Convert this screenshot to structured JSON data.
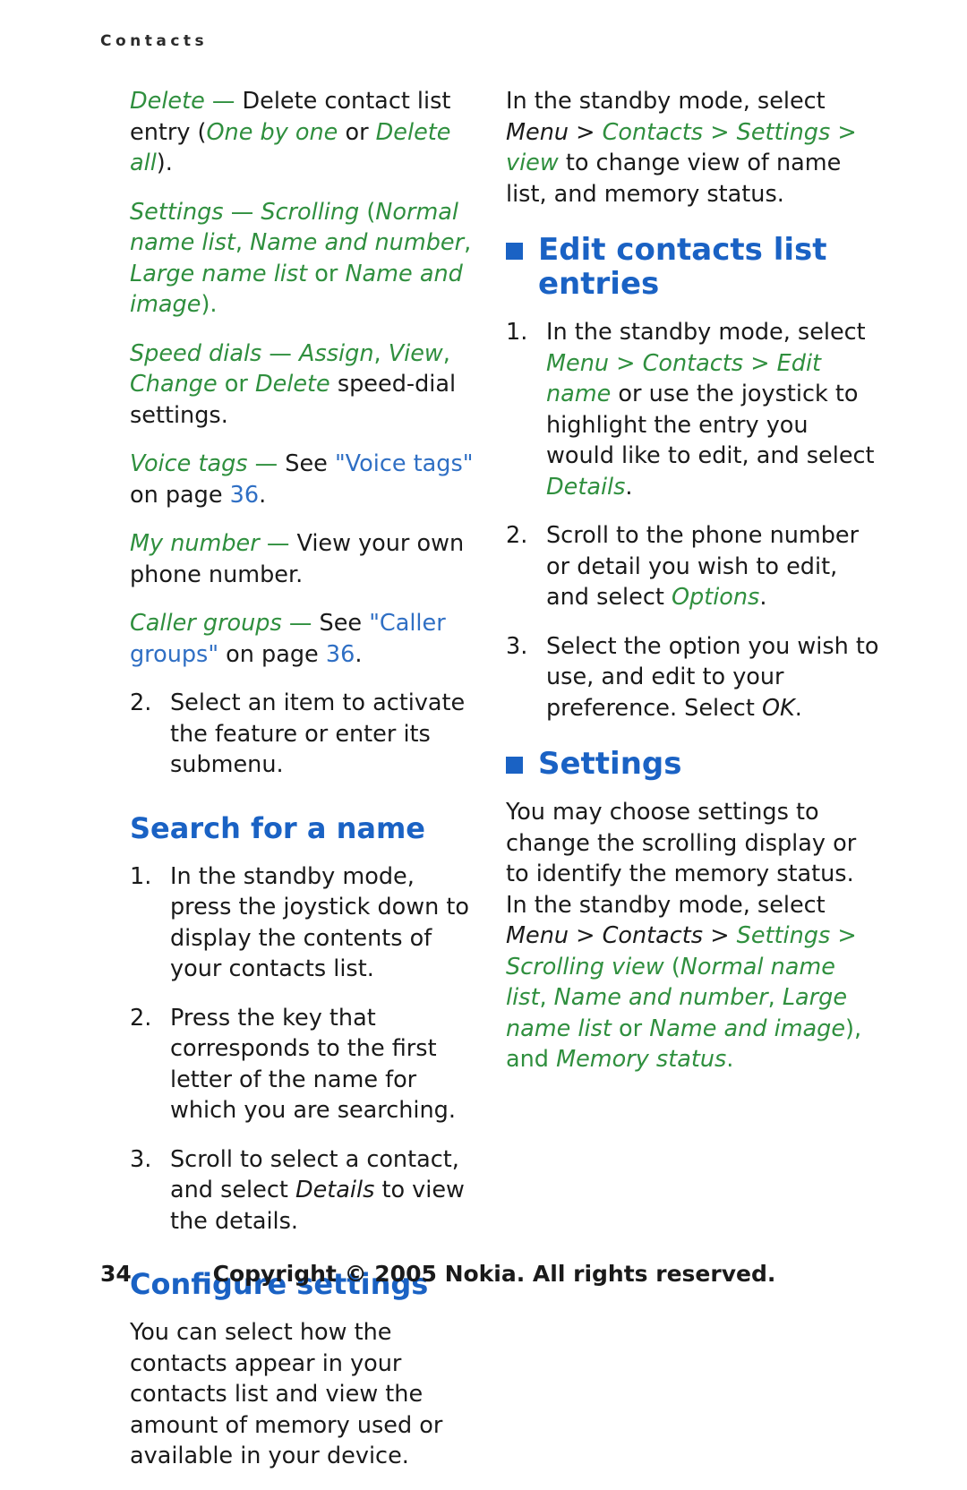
{
  "running_head": "Contacts",
  "left_column": {
    "para_delete": {
      "term": "Delete",
      "dash": " — ",
      "text1": "Delete contact list entry (",
      "opt1": "One by one",
      "mid": " or ",
      "opt2": "Delete all",
      "text2": ")."
    },
    "para_settings": {
      "term": "Settings",
      "dash": " — ",
      "sub": "Scrolling",
      "open": " (",
      "opt1": "Normal name list",
      "sep1": ", ",
      "opt2": "Name and number",
      "sep2": ", ",
      "opt3": "Large name list",
      "mid": " or ",
      "opt4": "Name and image",
      "close": ")."
    },
    "para_speed": {
      "term": "Speed dials",
      "dash": " — ",
      "opt1": "Assign",
      "sep1": ", ",
      "opt2": "View",
      "sep2": ", ",
      "opt3": "Change",
      "mid": " or ",
      "opt4": "Delete",
      "tail": " speed-dial settings."
    },
    "para_voice": {
      "term": "Voice tags",
      "dash": " — ",
      "text1": "See ",
      "link": "\"Voice tags\"",
      "text2": " on page ",
      "page": "36",
      "text3": "."
    },
    "para_mynumber": {
      "term": "My number",
      "dash": " — ",
      "text": "View your own phone number."
    },
    "para_caller": {
      "term": "Caller groups",
      "dash": " — ",
      "text1": "See ",
      "link": "\"Caller groups\"",
      "text2": " on page ",
      "page": "36",
      "text3": "."
    },
    "item2": {
      "num": "2.",
      "text": "Select an item to activate the feature or enter its submenu."
    },
    "search_heading": "Search for a name",
    "search_steps": [
      {
        "num": "1.",
        "text": "In the standby mode, press the joystick down to display the contents of your contacts list."
      },
      {
        "num": "2.",
        "text": "Press the key that corresponds to the first letter of the name for which you are searching."
      }
    ],
    "search_step3": {
      "num": "3.",
      "text1": "Scroll to select a contact, and select ",
      "italic": "Details",
      "text2": " to view the details."
    },
    "configure_heading": "Configure settings",
    "configure_text": "You can select how the contacts appear in your contacts list and view the amount of memory used or available in your device."
  },
  "right_column": {
    "intro": {
      "text1": "In the standby mode, select ",
      "m1": "Menu",
      "gt1": " > ",
      "m2": "Contacts",
      "gt2": " > ",
      "m3": "Settings",
      "gt3": " > ",
      "m4": "view",
      "text2": " to change view of name list, and memory status."
    },
    "edit_heading": "Edit contacts list entries",
    "edit_steps": {
      "step1": {
        "num": "1.",
        "text1": "In the standby mode, select ",
        "m1": "Menu",
        "gt1": " > ",
        "m2": "Contacts",
        "gt2": " > ",
        "m3": "Edit name",
        "text2": " or use the joystick to highlight the entry you would like to edit, and select ",
        "m4": "Details",
        "text3": "."
      },
      "step2": {
        "num": "2.",
        "text1": "Scroll to the phone number or detail you wish to edit, and select ",
        "m1": "Options",
        "text2": "."
      },
      "step3": {
        "num": "3.",
        "text1": "Select the option you wish to use, and edit to your preference. Select ",
        "m1": "OK",
        "text2": "."
      }
    },
    "settings_heading": "Settings",
    "settings_text": {
      "text1": "You may choose settings to change the scrolling display or to identify the memory status. In the standby mode, select ",
      "m1": "Menu",
      "gt1": " > ",
      "m2": "Contacts",
      "gt2": " > ",
      "m3": "Settings",
      "gt3": " > ",
      "m4": "Scrolling view",
      "open": " (",
      "o1": "Normal name list",
      "s1": ", ",
      "o2": "Name and number",
      "s2": ", ",
      "o3": "Large name list",
      "mid": " or ",
      "o4": "Name and image",
      "close": "), and ",
      "m5": "Memory status",
      "end": "."
    }
  },
  "footer": {
    "page_number": "34",
    "copyright": "Copyright © 2005 Nokia. All rights reserved."
  },
  "colors": {
    "heading_blue": "#1a62c4",
    "green": "#2f8f3e",
    "link_blue": "#2f6fc4"
  }
}
